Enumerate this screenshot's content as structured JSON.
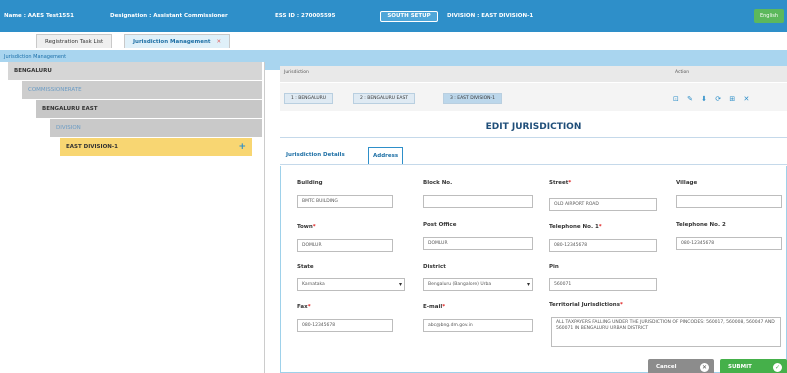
{
  "header": {
    "name": "Name : AAES Test1551",
    "designation": "Designation : Assistant Commissioner",
    "ess_id": "ESS ID : 270005595",
    "setup_button": "SOUTH SETUP",
    "division": "DIVISION : EAST DIVISION-1",
    "language_button": "English"
  },
  "tabs": [
    {
      "label": "Registration Task List"
    },
    {
      "label": "Jurisdiction Management",
      "close": "✕"
    }
  ],
  "breadcrumb": "Jurisdiction Management",
  "tree": {
    "items": [
      {
        "label": "BENGALURU"
      },
      {
        "label": "COMMISSIONERATE"
      },
      {
        "label": "BENGALURU EAST"
      },
      {
        "label": "DIVISION"
      },
      {
        "label": "EAST DIVISION-1",
        "action_icon": "+"
      }
    ]
  },
  "jurisdiction": {
    "col_jurisdiction": "Jurisdiction",
    "col_action": "Action",
    "crumbs": [
      "1 : BENGALURU",
      "2 : BENGALURU EAST",
      "3 : EAST DIVISION-1"
    ],
    "action_icons": "⊡ ✎ ⬇ ⟳ ⊞ ✕"
  },
  "edit_title": "EDIT JURISDICTION",
  "subtabs": {
    "details": "Jurisdiction Details",
    "address": "Address"
  },
  "form": {
    "building_label": "Building",
    "building_value": "BMTC BUILDING",
    "block_label": "Block No.",
    "block_value": "",
    "street_label": "Street",
    "street_value": "OLD AIRPORT ROAD",
    "village_label": "Village",
    "village_value": "",
    "town_label": "Town",
    "town_value": "DOMLUR",
    "postoffice_label": "Post Office",
    "postoffice_value": "DOMLUR",
    "tel1_label": "Telephone No. 1",
    "tel1_value": "080-12345678",
    "tel2_label": "Telephone No. 2",
    "tel2_value": "080-12345678",
    "state_label": "State",
    "state_value": "Karnataka",
    "district_label": "District",
    "district_value": "Bengaluru (Bangalore) Urba",
    "pin_label": "Pin",
    "pin_value": "560071",
    "fax_label": "Fax",
    "fax_value": "080-12345678",
    "email_label": "E-mail",
    "email_value": "abc@bng.dm.gov.in",
    "territorial_label": "Territorial Jurisdictions",
    "territorial_value": "ALL TAXPAYERS FALLING UNDER THE JURISDICTION OF PINCODES: 560017, 560008, 560047 AND 560071 IN BENGALURU URBAN DISTRICT"
  },
  "buttons": {
    "cancel": "Cancel",
    "submit": "SUBMIT"
  }
}
